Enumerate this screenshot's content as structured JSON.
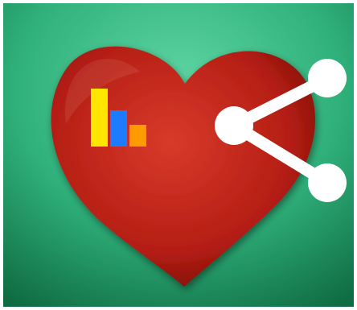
{
  "app_icon": {
    "icon_name": "health-share-app-icon",
    "colors": {
      "background_center": "#5fd6a4",
      "background_mid": "#2fb07a",
      "background_edge": "#0f6b42",
      "heart_light": "#d83a2a",
      "heart_base": "#b51e14",
      "heart_dark": "#7a0d08",
      "bar_yellow": "#ffe600",
      "bar_blue": "#1e7bff",
      "bar_orange": "#ff9a00",
      "share_white": "#ffffff"
    },
    "bars": [
      {
        "name": "yellow",
        "value": 1.0
      },
      {
        "name": "blue",
        "value": 0.62
      },
      {
        "name": "orange",
        "value": 0.38
      }
    ]
  }
}
